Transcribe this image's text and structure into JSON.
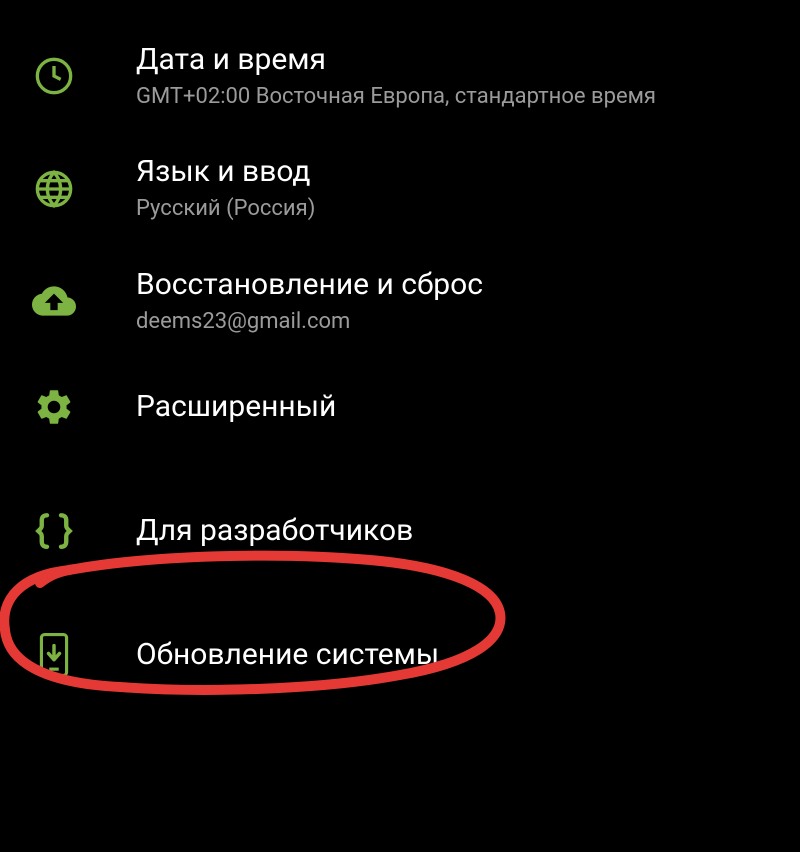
{
  "colors": {
    "accent": "#7cb342",
    "annotation": "#e53935"
  },
  "settings": {
    "items": [
      {
        "icon": "clock-icon",
        "title": "Дата и время",
        "subtitle": "GMT+02:00 Восточная Европа, стандартное время"
      },
      {
        "icon": "globe-icon",
        "title": "Язык и ввод",
        "subtitle": "Русский (Россия)"
      },
      {
        "icon": "cloud-upload-icon",
        "title": "Восстановление и сброс",
        "subtitle": "deems23@gmail.com"
      },
      {
        "icon": "gear-icon",
        "title": "Расширенный",
        "subtitle": null
      },
      {
        "icon": "braces-icon",
        "title": "Для разработчиков",
        "subtitle": null
      },
      {
        "icon": "system-update-icon",
        "title": "Обновление системы",
        "subtitle": null
      }
    ]
  }
}
